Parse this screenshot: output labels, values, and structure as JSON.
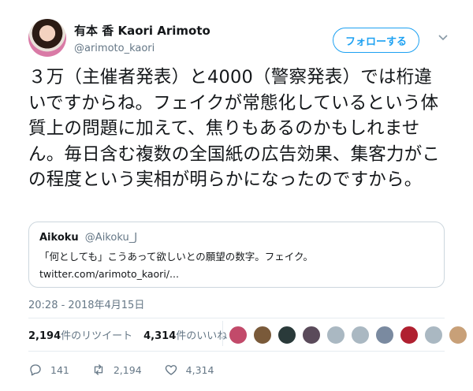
{
  "author": {
    "display_name": "有本 香 Kaori Arimoto",
    "handle": "@arimoto_kaori"
  },
  "follow_label": "フォローする",
  "tweet_text": "３万（主催者発表）と4000（警察発表）では桁違いですからね。フェイクが常態化しているという体質上の問題に加えて、焦りもあるのかもしれません。毎日含む複数の全国紙の広告効果、集客力がこの程度という実相が明らかになったのですから。",
  "quoted": {
    "name": "Aikoku",
    "handle": "@Aikoku_J",
    "text": "「何としても」こうあって欲しいとの願望の数字。フェイク。",
    "link": "twitter.com/arimoto_kaori/..."
  },
  "timestamp": "20:28 - 2018年4月15日",
  "stats": {
    "retweets_count": "2,194",
    "retweets_label": "件のリツイート",
    "likes_count": "4,314",
    "likes_label": "件のいいね"
  },
  "liker_colors": [
    "#c24a6a",
    "#7a5a3a",
    "#2a3a3a",
    "#5a4a5a",
    "#aab8c2",
    "#aab8c2",
    "#7a8aa0",
    "#b02030",
    "#aab8c2",
    "#c8a078"
  ],
  "actions": {
    "reply_count": "141",
    "retweet_count": "2,194",
    "like_count": "4,314"
  }
}
